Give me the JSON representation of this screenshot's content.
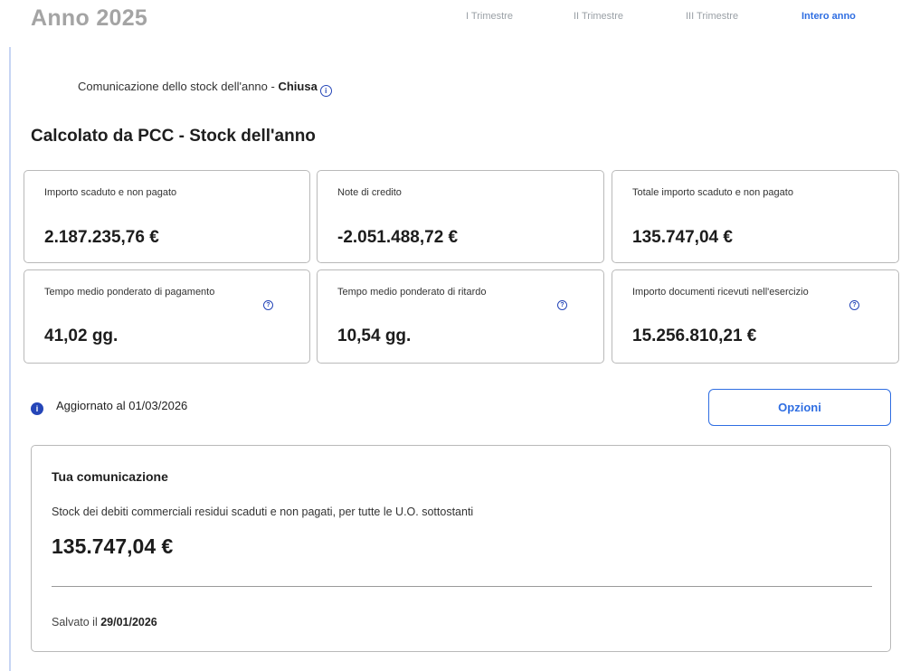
{
  "header": {
    "title": "Anno 2025",
    "tabs": [
      {
        "label": "I Trimestre",
        "active": false
      },
      {
        "label": "II Trimestre",
        "active": false
      },
      {
        "label": "III Trimestre",
        "active": false
      },
      {
        "label": "Intero anno",
        "active": true
      }
    ]
  },
  "communication_status": {
    "prefix": "Comunicazione dello stock dell'anno - ",
    "state": "Chiusa",
    "icon": "info-icon"
  },
  "section_title": "Calcolato da PCC - Stock dell'anno",
  "cards": [
    {
      "label": "Importo scaduto e non pagato",
      "value": "2.187.235,76 €"
    },
    {
      "label": "Note di credito",
      "value": "-2.051.488,72 €"
    },
    {
      "label": "Totale importo scaduto e non pagato",
      "value": "135.747,04 €"
    },
    {
      "label": "Tempo medio ponderato di pagamento",
      "value": "41,02 gg.",
      "icon": "help-icon"
    },
    {
      "label": "Tempo medio ponderato di ritardo",
      "value": "10,54 gg.",
      "icon": "help-icon"
    },
    {
      "label": "Importo documenti ricevuti nell'esercizio",
      "value": "15.256.810,21 €",
      "icon": "help-icon"
    }
  ],
  "update": {
    "text": "Aggiornato al 01/03/2026",
    "icon": "info-icon"
  },
  "options_button": "Opzioni",
  "communication": {
    "title": "Tua comunicazione",
    "description": "Stock dei debiti commerciali residui scaduti e non pagati, per tutte le U.O. sottostanti",
    "amount": "135.747,04 €",
    "saved_prefix": "Salvato il ",
    "saved_date": "29/01/2026"
  },
  "colors": {
    "accent": "#2f6ee2",
    "icon_blue": "#2546b8",
    "border": "#b9b9b9",
    "left_rule": "#c7d5f4"
  }
}
